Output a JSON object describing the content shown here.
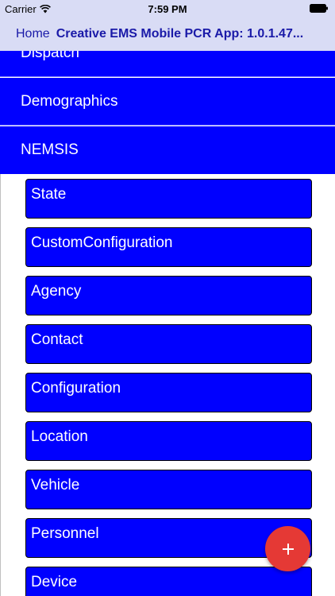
{
  "status_bar": {
    "carrier": "Carrier",
    "time": "7:59 PM",
    "icons": [
      "wifi-icon",
      "battery-icon"
    ]
  },
  "nav": {
    "back_label": "Home",
    "title": "Creative EMS Mobile PCR App: 1.0.1.47..."
  },
  "sections": {
    "dispatch": "Dispatch",
    "demographics": "Demographics",
    "nemsis": "NEMSIS"
  },
  "nemsis_items": [
    "State",
    "CustomConfiguration",
    "Agency",
    "Contact",
    "Configuration",
    "Location",
    "Vehicle",
    "Personnel",
    "Device"
  ],
  "fab": {
    "icon": "plus-icon",
    "color": "#e53935"
  },
  "colors": {
    "accent": "#0000ff",
    "nav_background": "#d9dcf5",
    "nav_text": "#1a1aa8"
  }
}
